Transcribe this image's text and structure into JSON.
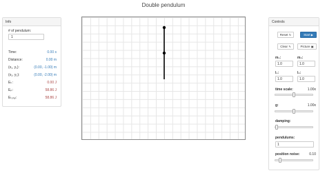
{
  "app": {
    "title": "Double pendulum"
  },
  "info": {
    "header": "Info",
    "num_pendulum_label": "# of pendulum:",
    "num_pendulum_value": "1",
    "rows": [
      {
        "label": "Time:",
        "value": "0.00 s",
        "color": "blue"
      },
      {
        "label": "Distance:",
        "value": "0.00 m",
        "color": "blue"
      },
      {
        "label": "(x₁, y₁):",
        "value": "(0.00, -1.00) m",
        "color": "blue"
      },
      {
        "label": "(x₂, y₂):",
        "value": "(0.00, -2.00) m",
        "color": "blue"
      },
      {
        "label": "Eₖ:",
        "value": "0.00 J",
        "color": "red"
      },
      {
        "label": "Eₚ:",
        "value": "58.86 J",
        "color": "red"
      },
      {
        "label": "Eₜₒₜₐₗ:",
        "value": "58.86 J",
        "color": "red"
      }
    ]
  },
  "controls": {
    "header": "Controls",
    "reset_label": "Reset",
    "start_label": "Start",
    "clear_label": "Clear",
    "picture_label": "Picture",
    "m1_label": "m₁:",
    "m1_value": "1.0",
    "m2_label": "m₂:",
    "m2_value": "1.0",
    "l1_label": "l₁:",
    "l1_value": "1.0",
    "l2_label": "l₂:",
    "l2_value": "1.0",
    "time_scale_label": "time scale:",
    "time_scale_value": "1.00x",
    "time_scale_level": 0.5,
    "g_label": "g:",
    "g_value": "1.00x",
    "g_level": 0.5,
    "damping_label": "damping:",
    "damping_value": "0",
    "damping_level": 0.0,
    "pendulums_label": "pendulums:",
    "pendulums_value": "1",
    "position_noise_label": "position noise:",
    "position_noise_value": "0.10",
    "position_noise_level": 0.1
  },
  "icons": {
    "reset": "refresh-icon",
    "start": "play-icon",
    "clear": "eraser-icon",
    "picture": "picture-icon"
  }
}
